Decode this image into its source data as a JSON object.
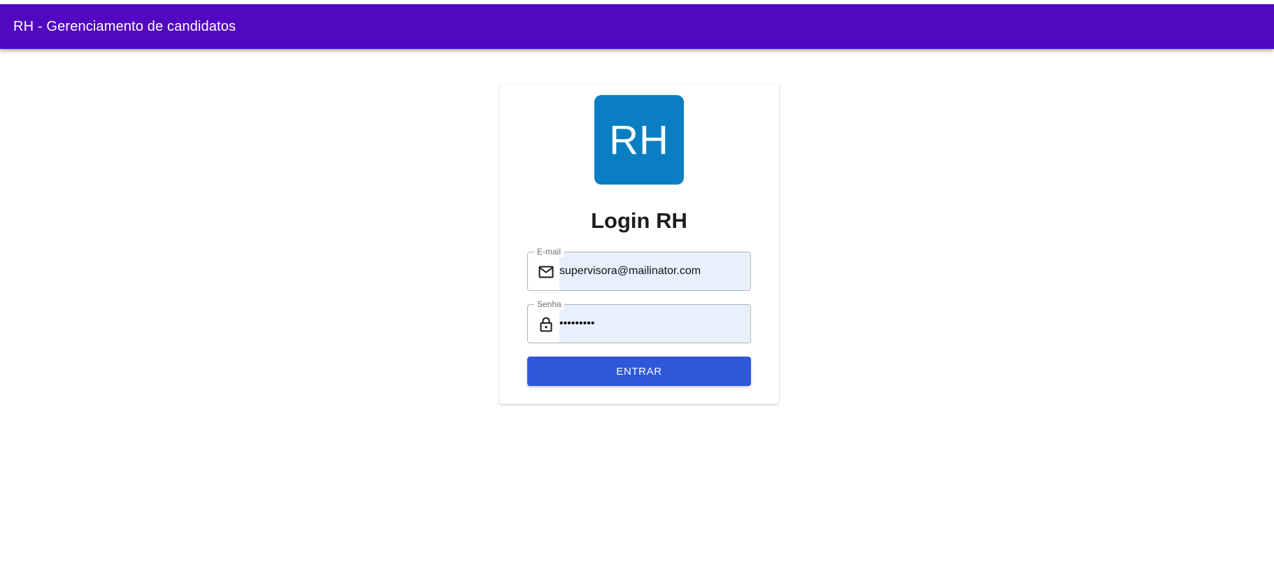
{
  "app_bar": {
    "title": "RH - Gerenciamento de candidatos",
    "color": "#5108c0"
  },
  "login_card": {
    "logo_text": "RH",
    "logo_color": "#0a7ec2",
    "heading": "Login RH",
    "email_field": {
      "label": "E-mail",
      "value": "supervisora@mailinator.com",
      "icon": "mail-icon"
    },
    "password_field": {
      "label": "Senha",
      "value": "•••••••••",
      "icon": "lock-icon"
    },
    "submit_button": {
      "label": "ENTRAR",
      "color": "#2f57d9"
    }
  }
}
